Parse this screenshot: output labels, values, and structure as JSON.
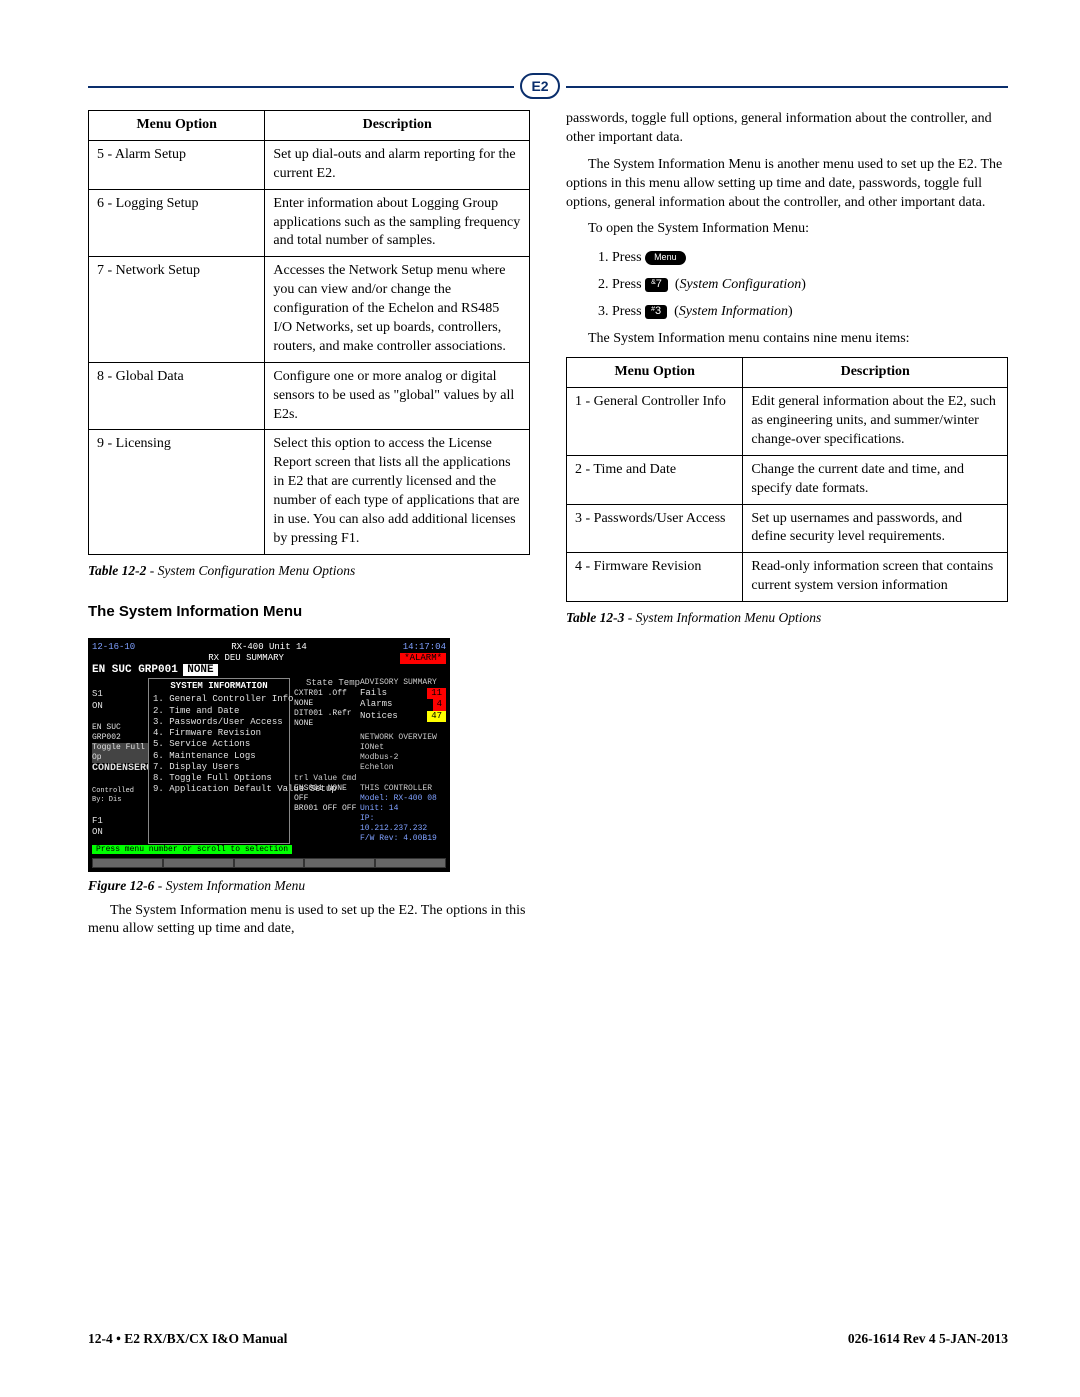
{
  "header": {
    "logo_text": "E2"
  },
  "leftColumn": {
    "table12_2": {
      "headers": [
        "Menu Option",
        "Description"
      ],
      "rows": [
        {
          "option": "5 - Alarm Setup",
          "desc": "Set up dial-outs and alarm reporting for the current E2."
        },
        {
          "option": "6 - Logging Setup",
          "desc": "Enter information about Logging Group applications such as the sampling frequency and total number of samples."
        },
        {
          "option": "7 - Network Setup",
          "desc": "Accesses the Network Setup menu where you can view and/or change the configuration of the Echelon and RS485 I/O Networks, set up boards, controllers, routers, and make controller associations."
        },
        {
          "option": "8 - Global Data",
          "desc": "Configure one or more analog or digital sensors to be used as \"global\" values by all E2s."
        },
        {
          "option": "9 - Licensing",
          "desc": "Select this option to access the License Report screen that lists all the applications in E2 that are currently licensed and the number of each type of applications that are in use. You can also add additional licenses by pressing F1."
        }
      ],
      "caption_bold": "Table 12-2",
      "caption_rest": " - System Configuration Menu Options"
    },
    "section_title": "The System Information Menu",
    "figure": {
      "date": "12-16-10",
      "unit": "RX-400 Unit 14",
      "screen": "RX DEU SUMMARY",
      "time": "14:17:04",
      "alarm": "*ALARM*",
      "group": "EN SUC GRP001",
      "none": "NONE",
      "menu_title": "SYSTEM INFORMATION",
      "menu_items": [
        "1.  General Controller Info",
        "2.  Time and Date",
        "3.  Passwords/User Access",
        "4.  Firmware Revision",
        "5.  Service Actions",
        "6.  Maintenance Logs",
        "7.  Display Users",
        "8.  Toggle Full Options",
        "9.  Application Default Value Setup"
      ],
      "left_labels": [
        "S1",
        "ON",
        "",
        "EN SUC GRP002",
        "Toggle Full Op",
        "CONDENSER0",
        "",
        "Controlled By: Dis",
        "",
        "F1",
        "ON"
      ],
      "state_temp": "State Temp",
      "ctr_lines": [
        "CXTR01 .Off  NONE",
        "DIT001 .Refr NONE"
      ],
      "adv_title": "ADVISORY SUMMARY",
      "adv_rows": [
        {
          "label": "Fails",
          "val": "11",
          "cls": "red"
        },
        {
          "label": "Alarms",
          "val": "4",
          "cls": "red"
        },
        {
          "label": "Notices",
          "val": "47",
          "cls": "yellow"
        }
      ],
      "net_title": "NETWORK OVERVIEW",
      "net_rows": [
        {
          "label": "IONet",
          "cls": "lt-red"
        },
        {
          "label": "Modbus-2",
          "cls": "lt-red"
        },
        {
          "label": "Echelon",
          "cls": "lt-red"
        }
      ],
      "tbl_hdr": "trl   Value  Cmd",
      "tbl_rows": [
        "ENS001 NONE   OFF",
        "BR001   OFF   OFF"
      ],
      "ctrl_title": "THIS CONTROLLER",
      "ctrl_rows": [
        "Model: RX-400  08",
        "Unit: 14",
        "IP: 10.212.237.232",
        "F/W Rev: 4.00B19"
      ],
      "hint": "Press menu number or scroll to selection"
    },
    "fig_caption_bold": "Figure 12-6",
    "fig_caption_rest": " - System Information Menu",
    "para_after_fig": "The System Information menu is used to set up the E2. The options in this menu allow setting up time and date,"
  },
  "rightColumn": {
    "para1": "passwords, toggle full options, general information about the controller, and other important data.",
    "para2": "The System Information Menu is another menu used to set up the E2. The options in this menu allow setting up time and date, passwords, toggle full options, general information about the controller, and other important data.",
    "para3": "To open the System Information Menu:",
    "steps": [
      {
        "pre": "Press ",
        "key_type": "oval",
        "key": "Menu",
        "post": ""
      },
      {
        "pre": "Press ",
        "key_type": "square",
        "key_sup": "&",
        "key": "7",
        "post": "System Configuration"
      },
      {
        "pre": "Press ",
        "key_type": "square",
        "key_sup": "#",
        "key": "3",
        "post": "System Information"
      }
    ],
    "para4": "The System Information menu contains nine menu items:",
    "table12_3": {
      "headers": [
        "Menu Option",
        "Description"
      ],
      "rows": [
        {
          "option": "1 - General Controller Info",
          "desc": "Edit general information about the E2, such as engineering units, and summer/winter change-over specifications."
        },
        {
          "option": "2 - Time and Date",
          "desc": "Change the current date and time, and specify date formats."
        },
        {
          "option": "3 - Passwords/User Access",
          "desc": "Set up usernames and passwords, and define security level requirements."
        },
        {
          "option": "4 - Firmware Revision",
          "desc": "Read-only information screen that contains current system version information"
        }
      ],
      "caption_bold": "Table 12-3",
      "caption_rest": " - System Information Menu Options"
    }
  },
  "footer": {
    "left": "12-4 • E2 RX/BX/CX I&O Manual",
    "right": "026-1614 Rev 4 5-JAN-2013"
  }
}
